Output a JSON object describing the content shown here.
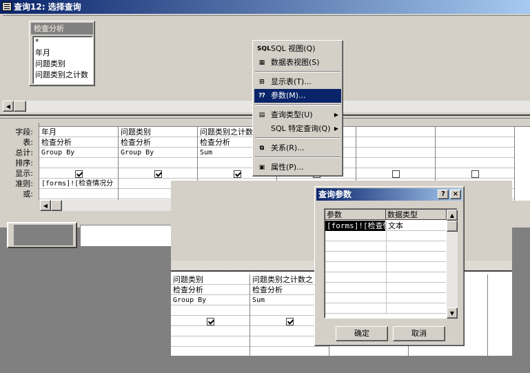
{
  "window": {
    "title": "查询12: 选择查询"
  },
  "table_box": {
    "name": "检查分析",
    "fields": [
      "*",
      "年月",
      "问题类别",
      "问题类别之计数"
    ]
  },
  "grid": {
    "row_labels": [
      "字段:",
      "表:",
      "总计:",
      "排序:",
      "显示:",
      "准则:",
      "或:"
    ],
    "columns": [
      {
        "field": "年月",
        "table": "检查分析",
        "total": "Group By",
        "sort": "",
        "show": true,
        "criteria": "[forms]![检查情况分",
        "or": ""
      },
      {
        "field": "问题类别",
        "table": "检查分析",
        "total": "Group By",
        "sort": "",
        "show": true,
        "criteria": "",
        "or": ""
      },
      {
        "field": "问题类别之计数",
        "table": "检查分析",
        "total": "Sum",
        "sort": "",
        "show": true,
        "criteria": "",
        "or": ""
      },
      {
        "field": "",
        "table": "",
        "total": "",
        "sort": "",
        "show": false,
        "criteria": "",
        "or": ""
      },
      {
        "field": "",
        "table": "",
        "total": "",
        "sort": "",
        "show": false,
        "criteria": "",
        "or": ""
      },
      {
        "field": "",
        "table": "",
        "total": "",
        "sort": "",
        "show": false,
        "criteria": "",
        "or": ""
      }
    ]
  },
  "context_menu": {
    "items": [
      {
        "label": "SQL 视图(Q)",
        "icon": "sql-icon"
      },
      {
        "label": "数据表视图(S)",
        "icon": "datasheet-icon"
      },
      {
        "label": "显示表(T)...",
        "icon": "show-table-icon"
      },
      {
        "label": "参数(M)...",
        "icon": "parameters-icon",
        "highlighted": true
      },
      {
        "label": "查询类型(U)",
        "icon": "query-type-icon",
        "submenu": true
      },
      {
        "label": "SQL 特定查询(Q)",
        "icon": "",
        "submenu": true
      },
      {
        "label": "关系(R)...",
        "icon": "relationships-icon"
      },
      {
        "label": "属性(P)...",
        "icon": "properties-icon"
      }
    ]
  },
  "second_window": {
    "columns": [
      {
        "field": "问题类别",
        "table": "检查分析",
        "total": "Group By",
        "show": true
      },
      {
        "field": "问题类别之计数之",
        "table": "检查分析",
        "total": "Sum",
        "show": true
      }
    ]
  },
  "dialog": {
    "title": "查询参数",
    "help_label": "?",
    "close_label": "×",
    "col_param": "参数",
    "col_type": "数据类型",
    "rows": [
      {
        "param": "[forms]![检查情",
        "type": "文本"
      }
    ],
    "ok_label": "确定",
    "cancel_label": "取消"
  }
}
